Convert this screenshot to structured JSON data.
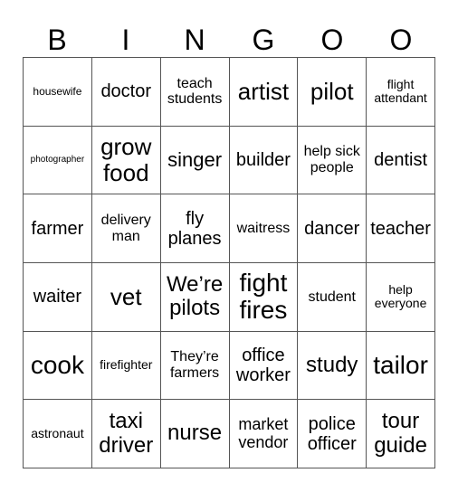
{
  "header": [
    "B",
    "I",
    "N",
    "G",
    "O",
    "O"
  ],
  "rows": [
    [
      {
        "text": "housewife",
        "size": "s12"
      },
      {
        "text": "doctor",
        "size": "s20"
      },
      {
        "text": "teach students",
        "size": "s16"
      },
      {
        "text": "artist",
        "size": "s26"
      },
      {
        "text": "pilot",
        "size": "s26"
      },
      {
        "text": "flight attendant",
        "size": "s14"
      }
    ],
    [
      {
        "text": "photographer",
        "size": "s10"
      },
      {
        "text": "grow food",
        "size": "s26"
      },
      {
        "text": "singer",
        "size": "s22"
      },
      {
        "text": "builder",
        "size": "s20"
      },
      {
        "text": "help sick people",
        "size": "s16"
      },
      {
        "text": "dentist",
        "size": "s20"
      }
    ],
    [
      {
        "text": "farmer",
        "size": "s20"
      },
      {
        "text": "delivery man",
        "size": "s16"
      },
      {
        "text": "fly planes",
        "size": "s20"
      },
      {
        "text": "waitress",
        "size": "s16"
      },
      {
        "text": "dancer",
        "size": "s20"
      },
      {
        "text": "teacher",
        "size": "s20"
      }
    ],
    [
      {
        "text": "waiter",
        "size": "s20"
      },
      {
        "text": "vet",
        "size": "s26"
      },
      {
        "text": "We’re pilots",
        "size": "s24"
      },
      {
        "text": "fight fires",
        "size": "s28"
      },
      {
        "text": "student",
        "size": "s16"
      },
      {
        "text": "help everyone",
        "size": "s14"
      }
    ],
    [
      {
        "text": "cook",
        "size": "s28"
      },
      {
        "text": "firefighter",
        "size": "s14"
      },
      {
        "text": "They’re farmers",
        "size": "s16"
      },
      {
        "text": "office worker",
        "size": "s20"
      },
      {
        "text": "study",
        "size": "s24"
      },
      {
        "text": "tailor",
        "size": "s28"
      }
    ],
    [
      {
        "text": "astronaut",
        "size": "s14"
      },
      {
        "text": "taxi driver",
        "size": "s24"
      },
      {
        "text": "nurse",
        "size": "s24"
      },
      {
        "text": "market vendor",
        "size": "s18"
      },
      {
        "text": "police officer",
        "size": "s20"
      },
      {
        "text": "tour guide",
        "size": "s24"
      }
    ]
  ]
}
